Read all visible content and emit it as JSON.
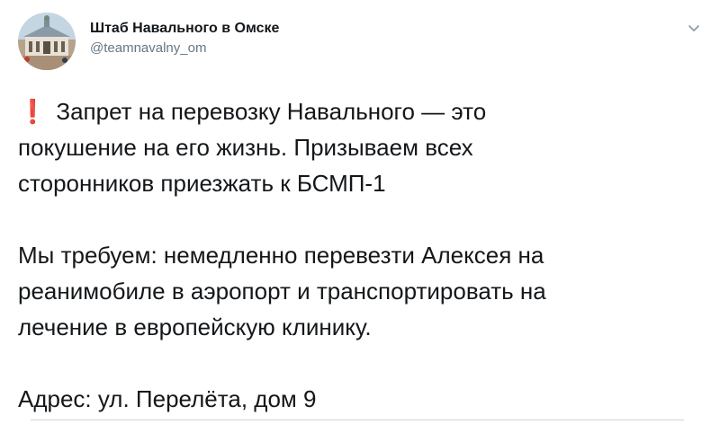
{
  "tweet": {
    "display_name": "Штаб Навального в Омске",
    "handle": "@teamnavalny_om",
    "icons": {
      "avatar": "building-photo-avatar",
      "menu": "chevron-down-icon",
      "emoji": "red-exclamation-mark-icon"
    },
    "emoji_glyph": "❗",
    "paragraphs": [
      {
        "lines": [
          "Запрет на перевозку Навального — это",
          "покушение на его жизнь. Призываем всех",
          "сторонников приезжать к БСМП-1"
        ]
      },
      {
        "lines": [
          "Мы требуем: немедленно перевезти Алексея на",
          "реанимобиле в аэропорт и транспортировать на",
          "лечение в европейскую клинику."
        ]
      },
      {
        "lines": [
          "Адрес: ул. Перелёта, дом 9"
        ]
      }
    ]
  },
  "colors": {
    "text": "#14171a",
    "secondary_text": "#657786",
    "emoji_red": "#d0021b",
    "divider": "#cfd6db"
  }
}
